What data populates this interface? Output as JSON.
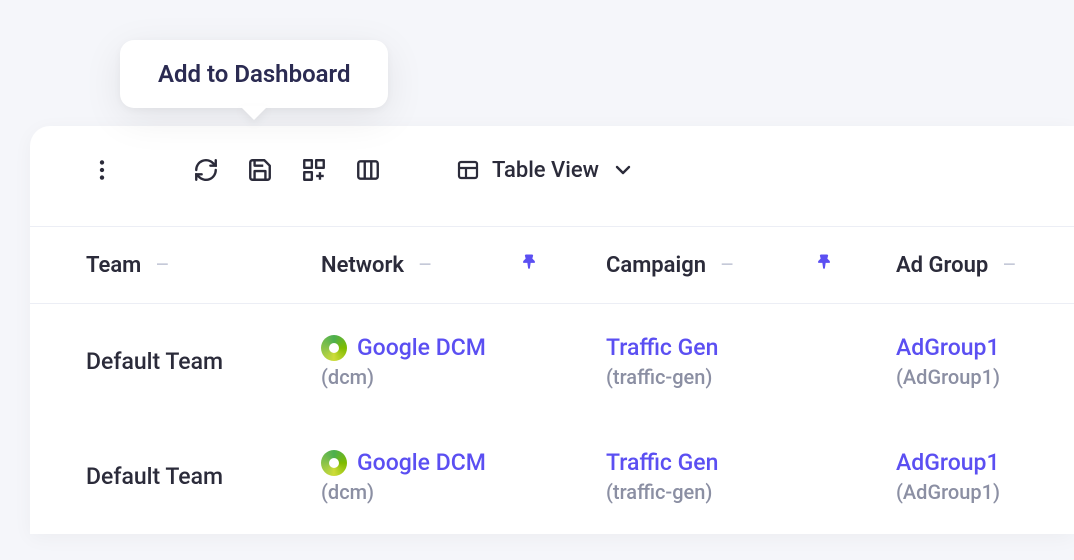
{
  "tooltip": {
    "text": "Add to Dashboard"
  },
  "viewDropdown": {
    "label": "Table View"
  },
  "columns": {
    "team": "Team",
    "network": "Network",
    "campaign": "Campaign",
    "adgroup": "Ad Group"
  },
  "rows": [
    {
      "team": "Default Team",
      "network_name": "Google DCM",
      "network_code": "(dcm)",
      "campaign_name": "Traffic Gen",
      "campaign_code": "(traffic-gen)",
      "adgroup_name": "AdGroup1",
      "adgroup_code": "(AdGroup1)"
    },
    {
      "team": "Default Team",
      "network_name": "Google DCM",
      "network_code": "(dcm)",
      "campaign_name": "Traffic Gen",
      "campaign_code": "(traffic-gen)",
      "adgroup_name": "AdGroup1",
      "adgroup_code": "(AdGroup1)"
    }
  ]
}
